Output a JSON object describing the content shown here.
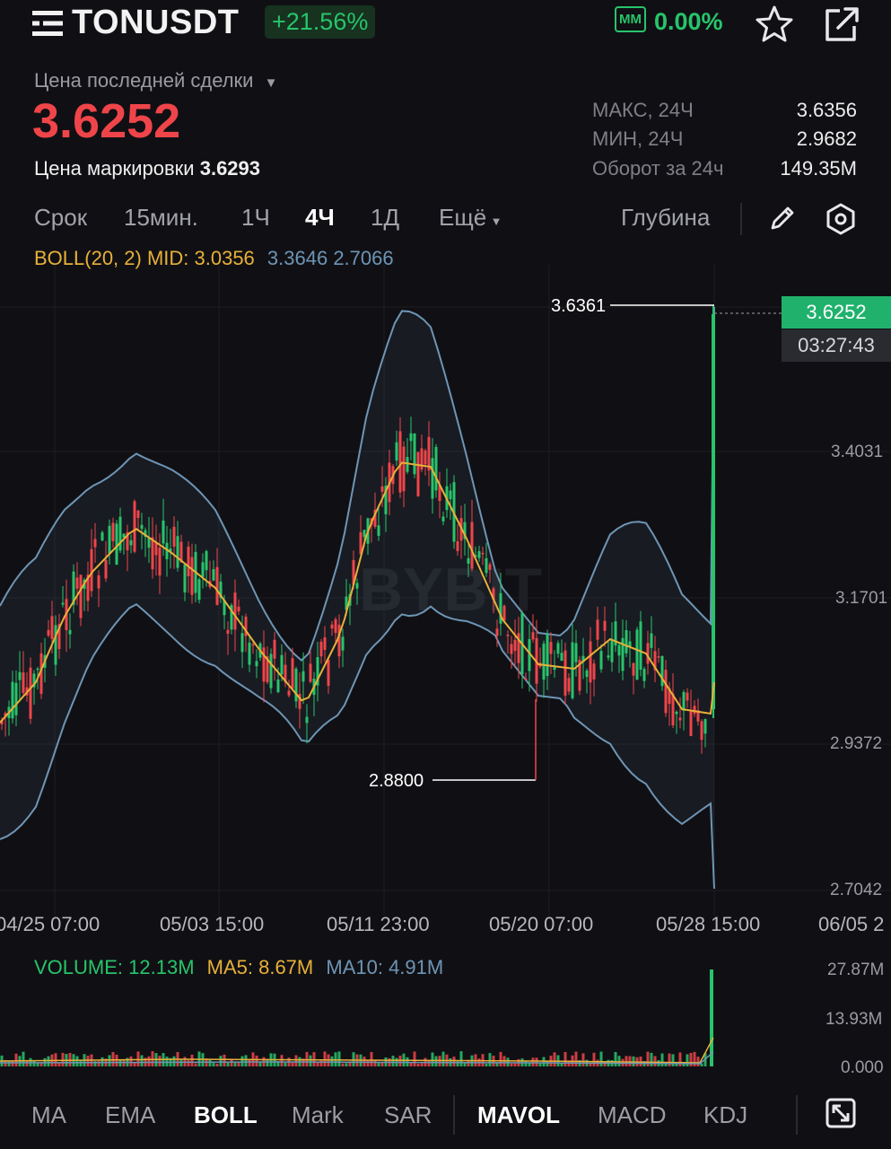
{
  "header": {
    "menu_icon": "menu-icon",
    "symbol": "TONUSDT",
    "change": "+21.56%",
    "mm_badge": "MM",
    "mm_value": "0.00%",
    "star_icon": "star-icon",
    "share_icon": "share-icon"
  },
  "price_panel": {
    "last_price_label": "Цена последней сделки",
    "last_price": "3.6252",
    "mark_price_label": "Цена маркировки",
    "mark_price": "3.6293",
    "stats": [
      {
        "label": "МАКС, 24Ч",
        "value": "3.6356"
      },
      {
        "label": "МИН, 24Ч",
        "value": "2.9682"
      },
      {
        "label": "Оборот за 24ч",
        "value": "149.35M"
      }
    ]
  },
  "timeframes": {
    "items": [
      {
        "label": "Срок",
        "active": false
      },
      {
        "label": "15мин.",
        "active": false
      },
      {
        "label": "1Ч",
        "active": false
      },
      {
        "label": "4Ч",
        "active": true
      },
      {
        "label": "1Д",
        "active": false
      },
      {
        "label": "Ещё",
        "active": false
      }
    ],
    "depth_label": "Глубина",
    "pencil_icon": "pencil-icon",
    "settings_icon": "settings-icon"
  },
  "boll_legend": {
    "mid": "BOLL(20, 2) MID: 3.0356",
    "upper_lower": "3.3646 2.7066"
  },
  "chart": {
    "watermark": "BYBIT",
    "current_price_tag": "3.6252",
    "countdown": "03:27:43",
    "high_marker": "3.6361",
    "low_marker": "2.8800",
    "y_ticks": [
      "3.4031",
      "3.1701",
      "2.9372",
      "2.7042"
    ],
    "x_ticks": [
      "04/25 07:00",
      "05/03 15:00",
      "05/11 23:00",
      "05/20 07:00",
      "05/28 15:00",
      "06/05 2"
    ],
    "colors": {
      "up": "#27c46b",
      "down": "#ef454a",
      "mid": "#e8b03a",
      "band": "#6e95b5"
    }
  },
  "chart_data": {
    "type": "candlestick",
    "y_axis": {
      "ticks": [
        3.4031,
        3.1701,
        2.9372,
        2.7042
      ],
      "range": [
        2.7042,
        3.6361
      ]
    },
    "annotations": {
      "high": 3.6361,
      "low": 2.88,
      "last": 3.6252
    },
    "indicators": {
      "boll_mid": 3.0356,
      "boll_upper": 3.3646,
      "boll_lower": 2.7066
    },
    "volume": {
      "current": "12.13M",
      "ma5": "8.67M",
      "ma10": "4.91M",
      "y_ticks": [
        "27.87M",
        "13.93M",
        "0.000"
      ]
    }
  },
  "volume_legend": {
    "volume": "VOLUME: 12.13M",
    "ma5": "MA5: 8.67M",
    "ma10": "MA10: 4.91M"
  },
  "indicator_tabs": {
    "items": [
      {
        "label": "MA",
        "active": false
      },
      {
        "label": "EMA",
        "active": false
      },
      {
        "label": "BOLL",
        "active": true
      },
      {
        "label": "Mark",
        "active": false
      },
      {
        "label": "SAR",
        "active": false
      },
      {
        "label": "MAVOL",
        "active": true
      },
      {
        "label": "MACD",
        "active": false
      },
      {
        "label": "KDJ",
        "active": false
      }
    ],
    "expand_icon": "expand-icon"
  }
}
